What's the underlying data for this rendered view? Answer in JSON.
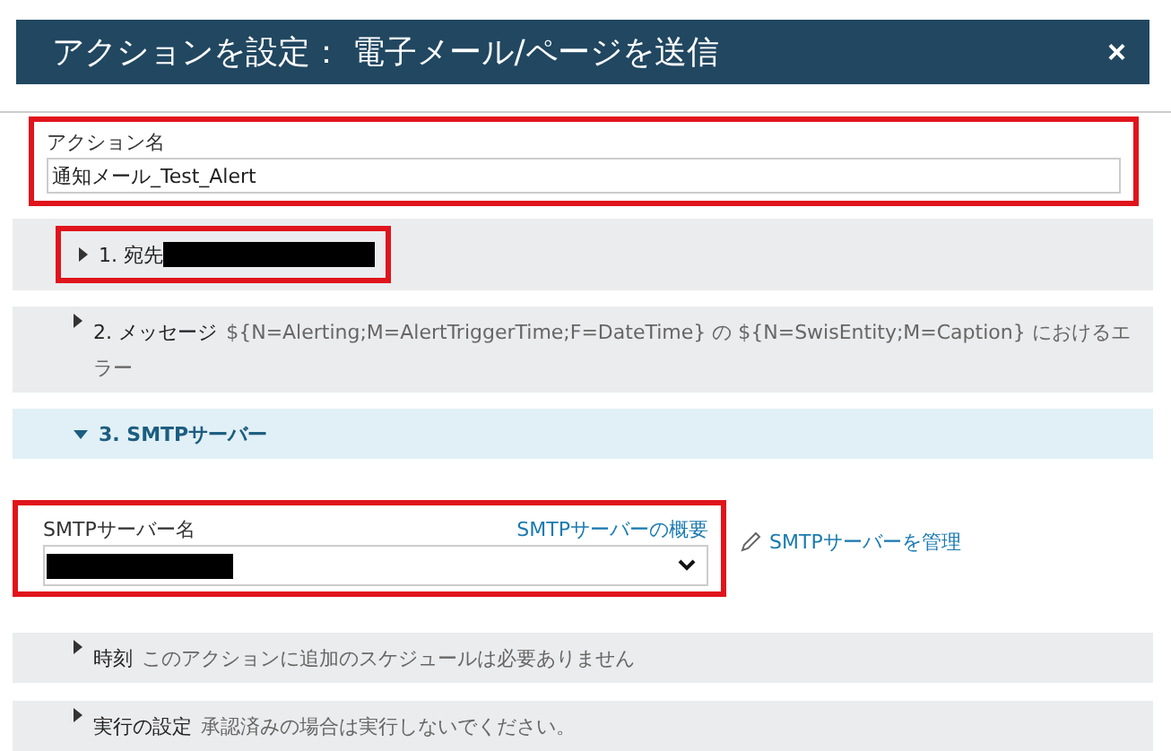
{
  "dialog": {
    "title": "アクションを設定： 電子メール/ページを送信",
    "close": "×"
  },
  "action_name": {
    "label": "アクション名",
    "value": "通知メール_Test_Alert",
    "highlighted": true
  },
  "sections": [
    {
      "title": "1. 宛先",
      "expanded": false,
      "redacted": true,
      "highlighted": true
    },
    {
      "title": "2. メッセージ",
      "summary": "${N=Alerting;M=AlertTriggerTime;F=DateTime} の ${N=SwisEntity;M=Caption} におけるエラー",
      "expanded": false,
      "redacted": false,
      "highlighted": false
    },
    {
      "title": "3. SMTPサーバー",
      "expanded": true,
      "redacted": false,
      "highlighted": false
    }
  ],
  "smtp": {
    "label": "SMTPサーバー名",
    "overview_link": "SMTPサーバーの概要",
    "manage_link": "SMTPサーバーを管理",
    "redacted": true,
    "highlighted": true
  },
  "bottom_sections": [
    {
      "title": "時刻",
      "summary": "このアクションに追加のスケジュールは必要ありません",
      "expanded": false
    },
    {
      "title": "実行の設定",
      "summary": "承認済みの場合は実行しないでください。",
      "expanded": false
    }
  ]
}
